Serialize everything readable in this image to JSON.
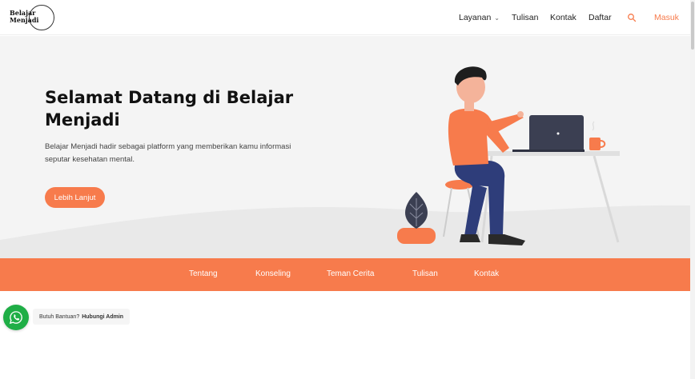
{
  "header": {
    "logo_line1": "Belajar",
    "logo_line2": "Menjadi",
    "nav": {
      "layanan": "Layanan",
      "tulisan": "Tulisan",
      "kontak": "Kontak",
      "daftar": "Daftar",
      "masuk": "Masuk"
    }
  },
  "hero": {
    "title": "Selamat Datang di Belajar Menjadi",
    "description": "Belajar Menjadi hadir sebagai platform yang memberikan kamu informasi seputar kesehatan mental.",
    "cta_label": "Lebih Lanjut"
  },
  "subnav": {
    "items": [
      "Tentang",
      "Konseling",
      "Teman Cerita",
      "Tulisan",
      "Kontak"
    ]
  },
  "whatsapp": {
    "label_prefix": "Butuh Bantuan?",
    "label_bold": "Hubungi Admin"
  },
  "colors": {
    "accent": "#f77b4c",
    "whatsapp": "#1fae46",
    "hero_bg": "#f4f4f4"
  }
}
